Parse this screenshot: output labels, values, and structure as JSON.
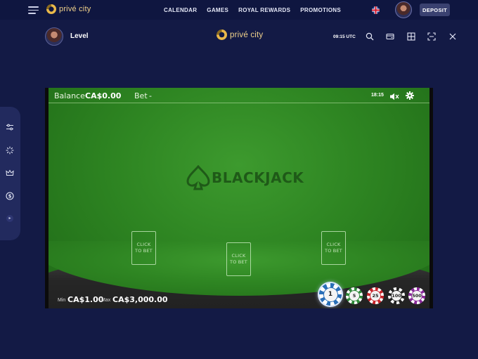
{
  "topnav": {
    "logo_text": "privé city",
    "links": [
      "CALENDAR",
      "GAMES",
      "ROYAL REWARDS",
      "PROMOTIONS"
    ],
    "deposit_label": "DEPOSIT"
  },
  "subbar": {
    "level_label": "Level",
    "logo_text": "privé city",
    "utc_time": "09:15 UTC"
  },
  "game": {
    "balance_label": "Balance",
    "balance_value": "CA$0.00",
    "bet_label": "Bet",
    "bet_value": "-",
    "clock": "18:15",
    "logo_text": "BLACKJACK",
    "bet_spots": [
      {
        "line1": "CLICK",
        "line2": "TO BET"
      },
      {
        "line1": "CLICK",
        "line2": "TO BET"
      },
      {
        "line1": "CLICK",
        "line2": "TO BET"
      }
    ],
    "min_label": "Min",
    "min_value": "CA$1.00",
    "max_label": "Max",
    "max_value": "CA$3,000.00",
    "chips": [
      {
        "value": "1",
        "color": "#2a6fb8",
        "selected": true
      },
      {
        "value": "5",
        "color": "#2f8a3a"
      },
      {
        "value": "25",
        "color": "#c8252b"
      },
      {
        "value": "100",
        "color": "#222222"
      },
      {
        "value": "500",
        "color": "#8a2a9a"
      }
    ]
  },
  "colors": {
    "page_bg": "#131a45",
    "nav_bg": "#0f1640",
    "felt": "#2e8522",
    "brand_gold": "#f1d28b"
  }
}
